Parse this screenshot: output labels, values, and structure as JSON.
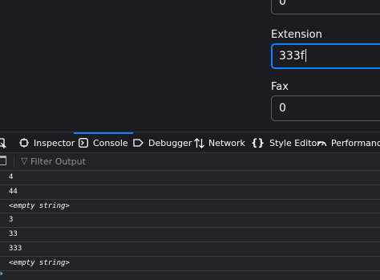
{
  "form": {
    "top_value": "0",
    "extension_label": "Extension",
    "extension_value": "333f",
    "fax_label": "Fax",
    "fax_value": "0"
  },
  "devtools": {
    "tabs": [
      {
        "label": "Inspector",
        "icon": "inspector-icon"
      },
      {
        "label": "Console",
        "icon": "console-icon",
        "selected": true
      },
      {
        "label": "Debugger",
        "icon": "debugger-icon"
      },
      {
        "label": "Network",
        "icon": "network-icon"
      },
      {
        "label": "Style Editor",
        "icon": "style-editor-icon"
      },
      {
        "label": "Performance",
        "icon": "performance-icon"
      }
    ],
    "filter_placeholder": "Filter Output",
    "messages": [
      "4",
      "44",
      "<empty string>",
      "3",
      "33",
      "333",
      "<empty string>"
    ],
    "prompt_symbol": "»"
  },
  "colors": {
    "background": "#1c1b22",
    "focus": "#0a84ff",
    "text": "#fbfbfe"
  }
}
